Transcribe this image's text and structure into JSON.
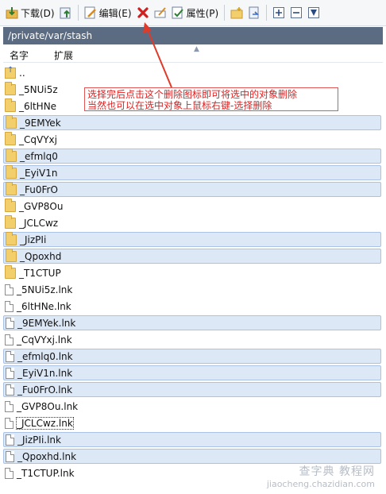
{
  "toolbar": {
    "download_label": "下载(D)",
    "edit_label": "编辑(E)",
    "properties_label": "属性(P)"
  },
  "path": "/private/var/stash",
  "columns": {
    "name": "名字",
    "ext": "扩展"
  },
  "rows": [
    {
      "name": "..",
      "type": "up",
      "selected": false
    },
    {
      "name": "_5NUi5z",
      "type": "folder",
      "selected": false
    },
    {
      "name": "_6ltHNe",
      "type": "folder",
      "selected": false
    },
    {
      "name": "_9EMYek",
      "type": "folder",
      "selected": true
    },
    {
      "name": "_CqVYxj",
      "type": "folder",
      "selected": false
    },
    {
      "name": "_efmlq0",
      "type": "folder",
      "selected": true
    },
    {
      "name": "_EyiV1n",
      "type": "folder",
      "selected": true
    },
    {
      "name": "_Fu0FrO",
      "type": "folder",
      "selected": true
    },
    {
      "name": "_GVP8Ou",
      "type": "folder",
      "selected": false
    },
    {
      "name": "_JCLCwz",
      "type": "folder",
      "selected": false
    },
    {
      "name": "_JizPIi",
      "type": "folder",
      "selected": true
    },
    {
      "name": "_Qpoxhd",
      "type": "folder",
      "selected": true
    },
    {
      "name": "_T1CTUP",
      "type": "folder",
      "selected": false
    },
    {
      "name": "_5NUi5z.lnk",
      "type": "file",
      "selected": false
    },
    {
      "name": "_6ltHNe.lnk",
      "type": "file",
      "selected": false
    },
    {
      "name": "_9EMYek.lnk",
      "type": "file",
      "selected": true
    },
    {
      "name": "_CqVYxj.lnk",
      "type": "file",
      "selected": false
    },
    {
      "name": "_efmlq0.lnk",
      "type": "file",
      "selected": true
    },
    {
      "name": "_EyiV1n.lnk",
      "type": "file",
      "selected": true
    },
    {
      "name": "_Fu0FrO.lnk",
      "type": "file",
      "selected": true
    },
    {
      "name": "_GVP8Ou.lnk",
      "type": "file",
      "selected": false
    },
    {
      "name": "_JCLCwz.lnk",
      "type": "file",
      "selected": false,
      "focused": true
    },
    {
      "name": "_JizPIi.lnk",
      "type": "file",
      "selected": true
    },
    {
      "name": "_Qpoxhd.lnk",
      "type": "file",
      "selected": true
    },
    {
      "name": "_T1CTUP.lnk",
      "type": "file",
      "selected": false
    }
  ],
  "annotation": {
    "line1": "选择完后点击这个删除图标即可将选中的对象删除",
    "line2": "当然也可以在选中对象上鼠标右键-选择删除"
  },
  "watermark": {
    "line1": "查字典 教程网",
    "line2": "jiaocheng.chazidian.com"
  },
  "colors": {
    "path_bar": "#5a6b82",
    "selection": "#dde8f7",
    "annotation_red": "#e02020"
  }
}
